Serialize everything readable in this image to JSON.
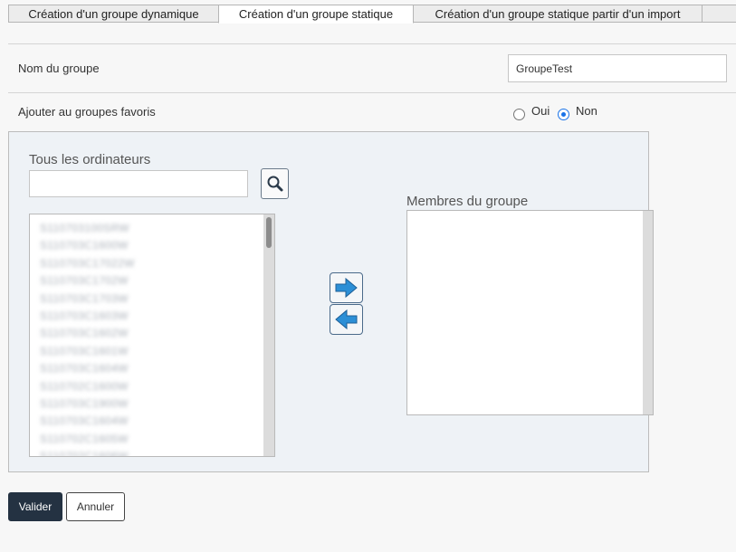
{
  "tabs": [
    {
      "label": "Création d'un groupe dynamique",
      "active": false
    },
    {
      "label": "Création d'un groupe statique",
      "active": true
    },
    {
      "label": "Création d'un groupe statique partir d'un import",
      "active": false
    },
    {
      "label": "",
      "active": false
    }
  ],
  "form": {
    "group_name_label": "Nom du groupe",
    "group_name_value": "GroupeTest",
    "favorites_label": "Ajouter au groupes favoris",
    "favorites_options": {
      "yes": "Oui",
      "no": "Non"
    },
    "favorites_selected": "Non"
  },
  "computers": {
    "title": "Tous les ordinateurs",
    "search_value": "",
    "items": [
      "S110703100SRW",
      "S110703C1600W",
      "S110703C17022W",
      "S110703C1702W",
      "S110703C1703W",
      "S110703C1603W",
      "S110703C1602W",
      "S110703C1601W",
      "S110703C1604W",
      "S110702C1600W",
      "S110703C1900W",
      "S110703C1604W",
      "S110702C1605W",
      "S110702C1606W"
    ]
  },
  "members": {
    "title": "Membres du groupe",
    "items": []
  },
  "buttons": {
    "submit": "Valider",
    "cancel": "Annuler"
  },
  "icons": {
    "search": "search-icon",
    "add": "arrow-right-icon",
    "remove": "arrow-left-icon"
  },
  "colors": {
    "accent": "#1a73e8",
    "arrow": "#2c8fd6",
    "primary_button": "#243242",
    "panel_bg": "#eef2f6"
  }
}
